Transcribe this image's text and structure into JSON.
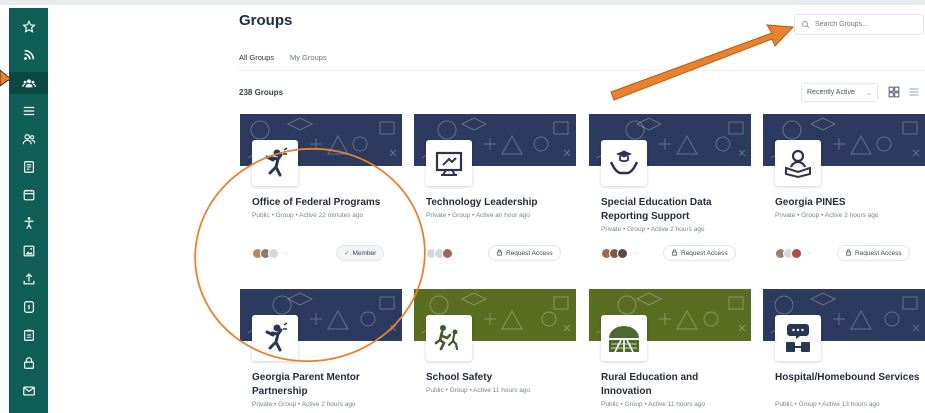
{
  "page": {
    "title": "Groups",
    "search_placeholder": "Search Groups...",
    "tabs": [
      {
        "label": "All Groups"
      },
      {
        "label": "My Groups"
      }
    ],
    "count_label": "238 Groups",
    "sort_label": "Recently Active",
    "sort_caret": "⌄"
  },
  "sidebar": {
    "items": [
      {
        "icon": "star-icon"
      },
      {
        "icon": "rss-icon"
      },
      {
        "icon": "groups-icon"
      },
      {
        "icon": "menu-icon"
      },
      {
        "icon": "users-icon"
      },
      {
        "icon": "document-icon"
      },
      {
        "icon": "calendar-icon"
      },
      {
        "icon": "accessibility-icon"
      },
      {
        "icon": "image-icon"
      },
      {
        "icon": "upload-icon"
      },
      {
        "icon": "file-icon"
      },
      {
        "icon": "clipboard-icon"
      },
      {
        "icon": "lock-icon"
      },
      {
        "icon": "mail-icon"
      }
    ]
  },
  "colors": {
    "sidebar": "#0f5f57",
    "banner_navy": "#2b3a5e",
    "banner_green": "#5a6e22",
    "annotation": "#e8822f",
    "accent_teal": "#1a8a80"
  },
  "groups": [
    {
      "title": "Office of Federal Programs",
      "meta": "Public • Group • Active 22 minutes ago",
      "action": "Member",
      "action_icon": "check-icon",
      "icon": "jumping-person-icon",
      "banner": "navy"
    },
    {
      "title": "Technology Leadership",
      "meta": "Private • Group • Active an hour ago",
      "action": "Request Access",
      "action_icon": "lock-icon",
      "icon": "presentation-screen-icon",
      "banner": "navy"
    },
    {
      "title": "Special Education Data Reporting Support",
      "meta": "Private • Group • Active 2 hours ago",
      "action": "Request Access",
      "action_icon": "lock-icon",
      "icon": "graduation-hands-icon",
      "banner": "navy"
    },
    {
      "title": "Georgia PINES",
      "meta": "Private • Group • Active 2 hours ago",
      "action": "Request Access",
      "action_icon": "lock-icon",
      "icon": "reader-icon",
      "banner": "navy"
    },
    {
      "title": "Georgia Parent Mentor Partnership",
      "meta": "Private • Group • Active 2 hours ago",
      "icon": "jumping-person-icon",
      "banner": "navy"
    },
    {
      "title": "School Safety",
      "meta": "Public • Group • Active 11 hours ago",
      "icon": "running-people-icon",
      "banner": "green"
    },
    {
      "title": "Rural Education and Innovation",
      "meta": "Public • Group • Active 11 hours ago",
      "icon": "rural-road-icon",
      "banner": "green"
    },
    {
      "title": "Hospital/Homebound Services",
      "meta": "Public • Group • Active 13 hours ago",
      "icon": "chat-person-icon",
      "banner": "navy"
    }
  ]
}
